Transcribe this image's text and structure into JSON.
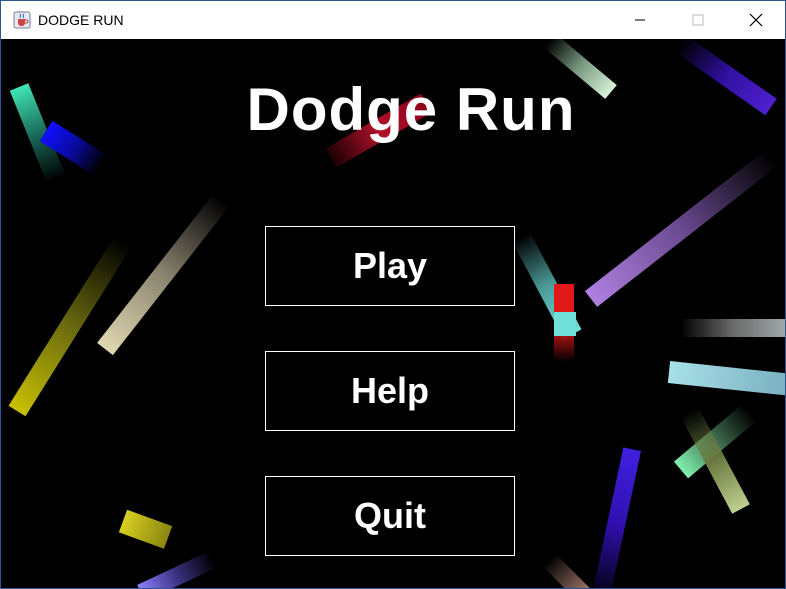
{
  "window": {
    "title": "DODGE RUN",
    "icons": {
      "app": "java-cup-icon",
      "minimize": "minimize-icon",
      "maximize": "maximize-icon",
      "close": "close-icon"
    }
  },
  "game": {
    "title": "Dodge Run",
    "menu": {
      "play_label": "Play",
      "help_label": "Help",
      "quit_label": "Quit"
    }
  },
  "colors": {
    "background": "#000000",
    "text": "#ffffff",
    "titlebar": "#ffffff"
  }
}
